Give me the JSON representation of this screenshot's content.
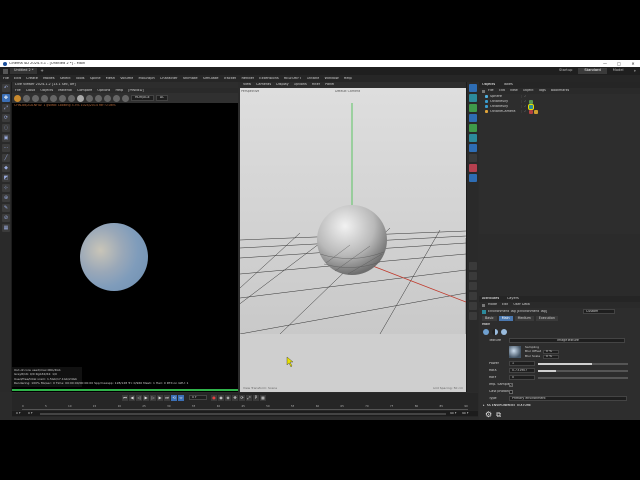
{
  "window": {
    "title": "Cinema 4D 2024.5.1 - [Untitled 2 *] - Main",
    "minimize_glyph": "—",
    "maximize_glyph": "□",
    "close_glyph": "✕"
  },
  "tabs": {
    "doc_tab": "Untitled 2 *",
    "layouts": [
      "Startup",
      "Standard",
      "Model"
    ],
    "active_layout": "Standard"
  },
  "menubar": {
    "items": [
      "File",
      "Edit",
      "Create",
      "Modes",
      "Select",
      "Tools",
      "Spline",
      "Mesh",
      "Volume",
      "MoGraph",
      "Character",
      "Animate",
      "Simulate",
      "Tracker",
      "Render",
      "Extensions",
      "REDSHIFT",
      "Octane",
      "Window",
      "Help"
    ]
  },
  "render_panel": {
    "header": "Live Viewer 2024.1.2 [13.1 Sec, off]",
    "menu": [
      "File",
      "Cloud",
      "Objects",
      "Material",
      "Compare",
      "Options",
      "Help",
      "[PINNED]"
    ],
    "mode_select": "HDR/AGE",
    "channel_select": "DL",
    "status": "CHN-8d/ZDLNFID: 1  gsx6a:  Looking 3.3%  1024/2014 rdr: 0.08%"
  },
  "render_stats": {
    "lines": [
      "Out-of-core used/max:0Kb/4Gb",
      "Grey8/16: 0/0           Rgb32/64: 1/0",
      "Used/free/total vram: 1.5Gb/17.1Gb/24Gb",
      "Rendering: 100%  Ms/sec: 0  Time: 00:00:00/00:00:00  Spp/maxspp: 128/128  Tri: 0/960  Mesh: 1  Hair: 0  RTX:on  GPU: 1"
    ],
    "progress": 1.0
  },
  "viewport": {
    "menu": [
      "View",
      "Cameras",
      "Display",
      "Options",
      "Filter",
      "Panel"
    ],
    "label": "Perspective",
    "camera": "Default Camera",
    "footer_left": "View Transform: Scene",
    "footer_right": "Grid Spacing: 50 cm"
  },
  "objects_panel": {
    "tabs": [
      "Objects",
      "Takes"
    ],
    "menu": [
      "File",
      "Edit",
      "View",
      "Object",
      "Tags",
      "Bookmarks"
    ],
    "items": [
      {
        "name": "Sphere",
        "color": "#4fb0e0",
        "tags": []
      },
      {
        "name": "OctaneSky",
        "color": "#3a9cd0",
        "tags": [
          "#5a9a50"
        ]
      },
      {
        "name": "OctaneSky",
        "color": "#3a9cd0",
        "tags": [
          "#2c8a9c"
        ]
      },
      {
        "name": "OctaneCamera",
        "color": "#e0a43a",
        "tags": [
          "#b54040",
          "#d0a030"
        ]
      }
    ]
  },
  "attributes": {
    "tabs": [
      "Attributes",
      "Layers"
    ],
    "menu": [
      "Mode",
      "Edit",
      "User Data"
    ],
    "title": "Environment Tag [Environment Tag]",
    "title_select": "Custom",
    "sub_tabs": [
      "Basic",
      "Main",
      "Medium",
      "Execution"
    ],
    "active_sub_tab": "Main",
    "section": "Main",
    "texture_label": "Texture",
    "texture_value": "ImageTexture",
    "sampling_label": "Sampling",
    "blur_offset_label": "Blur Offset",
    "blur_offset": "0 %",
    "blur_scale_label": "Blur Scale",
    "blur_scale": "0 %",
    "power_label": "Power",
    "power": "1",
    "power_level": 0.6,
    "rotX_label": "RotX",
    "rotX": "0.731907",
    "rotX_level": 0.2,
    "rotY_label": "RotY",
    "rotY": "0",
    "rotY_level": 0.0,
    "imp_sample_label": "Imp. Sample",
    "cast_photons_label": "Cast photons",
    "type_label": "Type",
    "type_value": "Primary environment",
    "as_env_texture": "AS ENVIRONMENT TEXTURE"
  },
  "timeline": {
    "current_frame": "0 F",
    "start": "0 F",
    "start2": "0 F",
    "end": "90 F",
    "end2": "90 F",
    "ticks": [
      "0",
      "5",
      "10",
      "15",
      "20",
      "25",
      "30",
      "35",
      "40",
      "45",
      "50",
      "55",
      "60",
      "65",
      "70",
      "75",
      "80",
      "85",
      "90"
    ]
  },
  "colors": {
    "accent_blue": "#3b6fb6",
    "progress_green": "#2fb34a",
    "axis_green": "#3bbf45",
    "axis_red": "#c0392b",
    "axis_blue": "#2f6fd0"
  }
}
